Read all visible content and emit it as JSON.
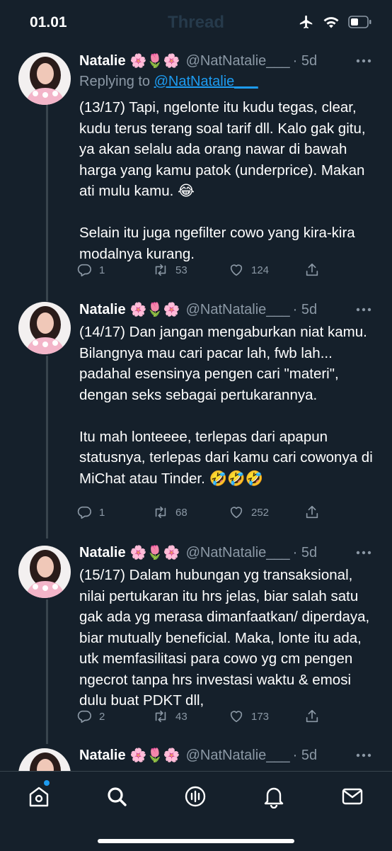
{
  "status_bar": {
    "time": "01.01"
  },
  "nav": {
    "title": "Thread"
  },
  "tweets": [
    {
      "name": "Natalie",
      "emojis": "🌸🌷🌸",
      "handle": "@NatNatalie___",
      "time": "· 5d",
      "replying_prefix": "Replying to ",
      "replying_handle": "@NatNatalie___",
      "text": "(13/17) Tapi, ngelonte itu kudu tegas, clear, kudu terus terang soal tarif dll. Kalo gak gitu, ya akan selalu ada orang nawar di bawah harga yang kamu patok (underprice). Makan ati mulu kamu. 😂\n\nSelain itu juga ngefilter cowo yang kira-kira modalnya kurang.",
      "replies": "1",
      "retweets": "53",
      "likes": "124"
    },
    {
      "name": "Natalie",
      "emojis": "🌸🌷🌸",
      "handle": "@NatNatalie___",
      "time": "· 5d",
      "text": "(14/17) Dan jangan mengaburkan niat kamu. Bilangnya mau cari pacar lah, fwb lah... padahal esensinya pengen cari \"materi\", dengan seks sebagai pertukarannya.\n\nItu mah lonteeee, terlepas dari apapun statusnya, terlepas dari kamu cari cowonya di MiChat atau Tinder. 🤣🤣🤣",
      "replies": "1",
      "retweets": "68",
      "likes": "252"
    },
    {
      "name": "Natalie",
      "emojis": "🌸🌷🌸",
      "handle": "@NatNatalie___",
      "time": "· 5d",
      "text": "(15/17) Dalam hubungan yg transaksional, nilai pertukaran itu hrs jelas, biar salah satu gak ada yg merasa dimanfaatkan/ diperdaya, biar mutually beneficial. Maka, lonte itu ada, utk memfasilitasi para cowo yg cm pengen ngecrot tanpa hrs investasi waktu & emosi dulu buat PDKT dll,",
      "replies": "2",
      "retweets": "43",
      "likes": "173"
    },
    {
      "name": "Natalie",
      "emojis": "🌸🌷🌸",
      "handle": "@NatNatalie___",
      "time": "· 5d"
    }
  ],
  "tab_bar": {
    "items": [
      "home-icon",
      "search-icon",
      "spaces-icon",
      "notifications-icon",
      "messages-icon"
    ],
    "accent": "#1d9bf0"
  },
  "colors": {
    "background": "#15202b",
    "secondary_text": "#8b98a5",
    "link": "#1d9bf0"
  }
}
